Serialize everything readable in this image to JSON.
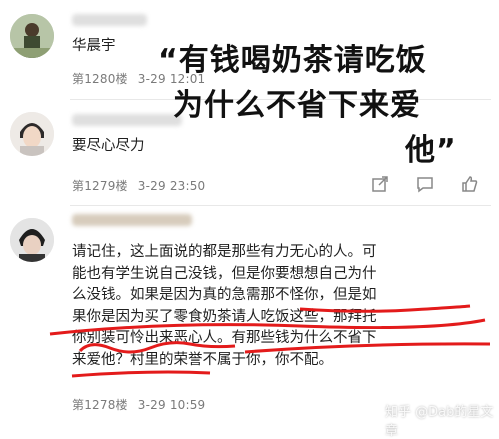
{
  "overlay_quote": {
    "line1": "“有钱喝奶茶请吃饭",
    "line2": "为什么不省下来爱",
    "line3": "他”"
  },
  "comments": [
    {
      "name": "华晨宇",
      "floor": "第1280楼",
      "time": "3-29 12:01"
    },
    {
      "text": "要尽心尽力",
      "floor": "第1279楼",
      "time": "3-29 23:50"
    },
    {
      "lines": [
        "请记住，这上面说的都是那些有力无心的人。可",
        "能也有学生说自己没钱，但是你要想想自己为什",
        "么没钱。如果是因为真的急需那不怪你，但是如",
        "果你是因为买了零食奶茶请人吃饭这些，那拜托",
        "你别装可怜出来恶心人。有那些钱为什么不省下",
        "来爱他？村里的荣誉不属于你，你不配。"
      ],
      "floor": "第1278楼",
      "time": "3-29 10:59"
    }
  ],
  "watermark": {
    "text": "知乎 @Dab的星文章"
  }
}
